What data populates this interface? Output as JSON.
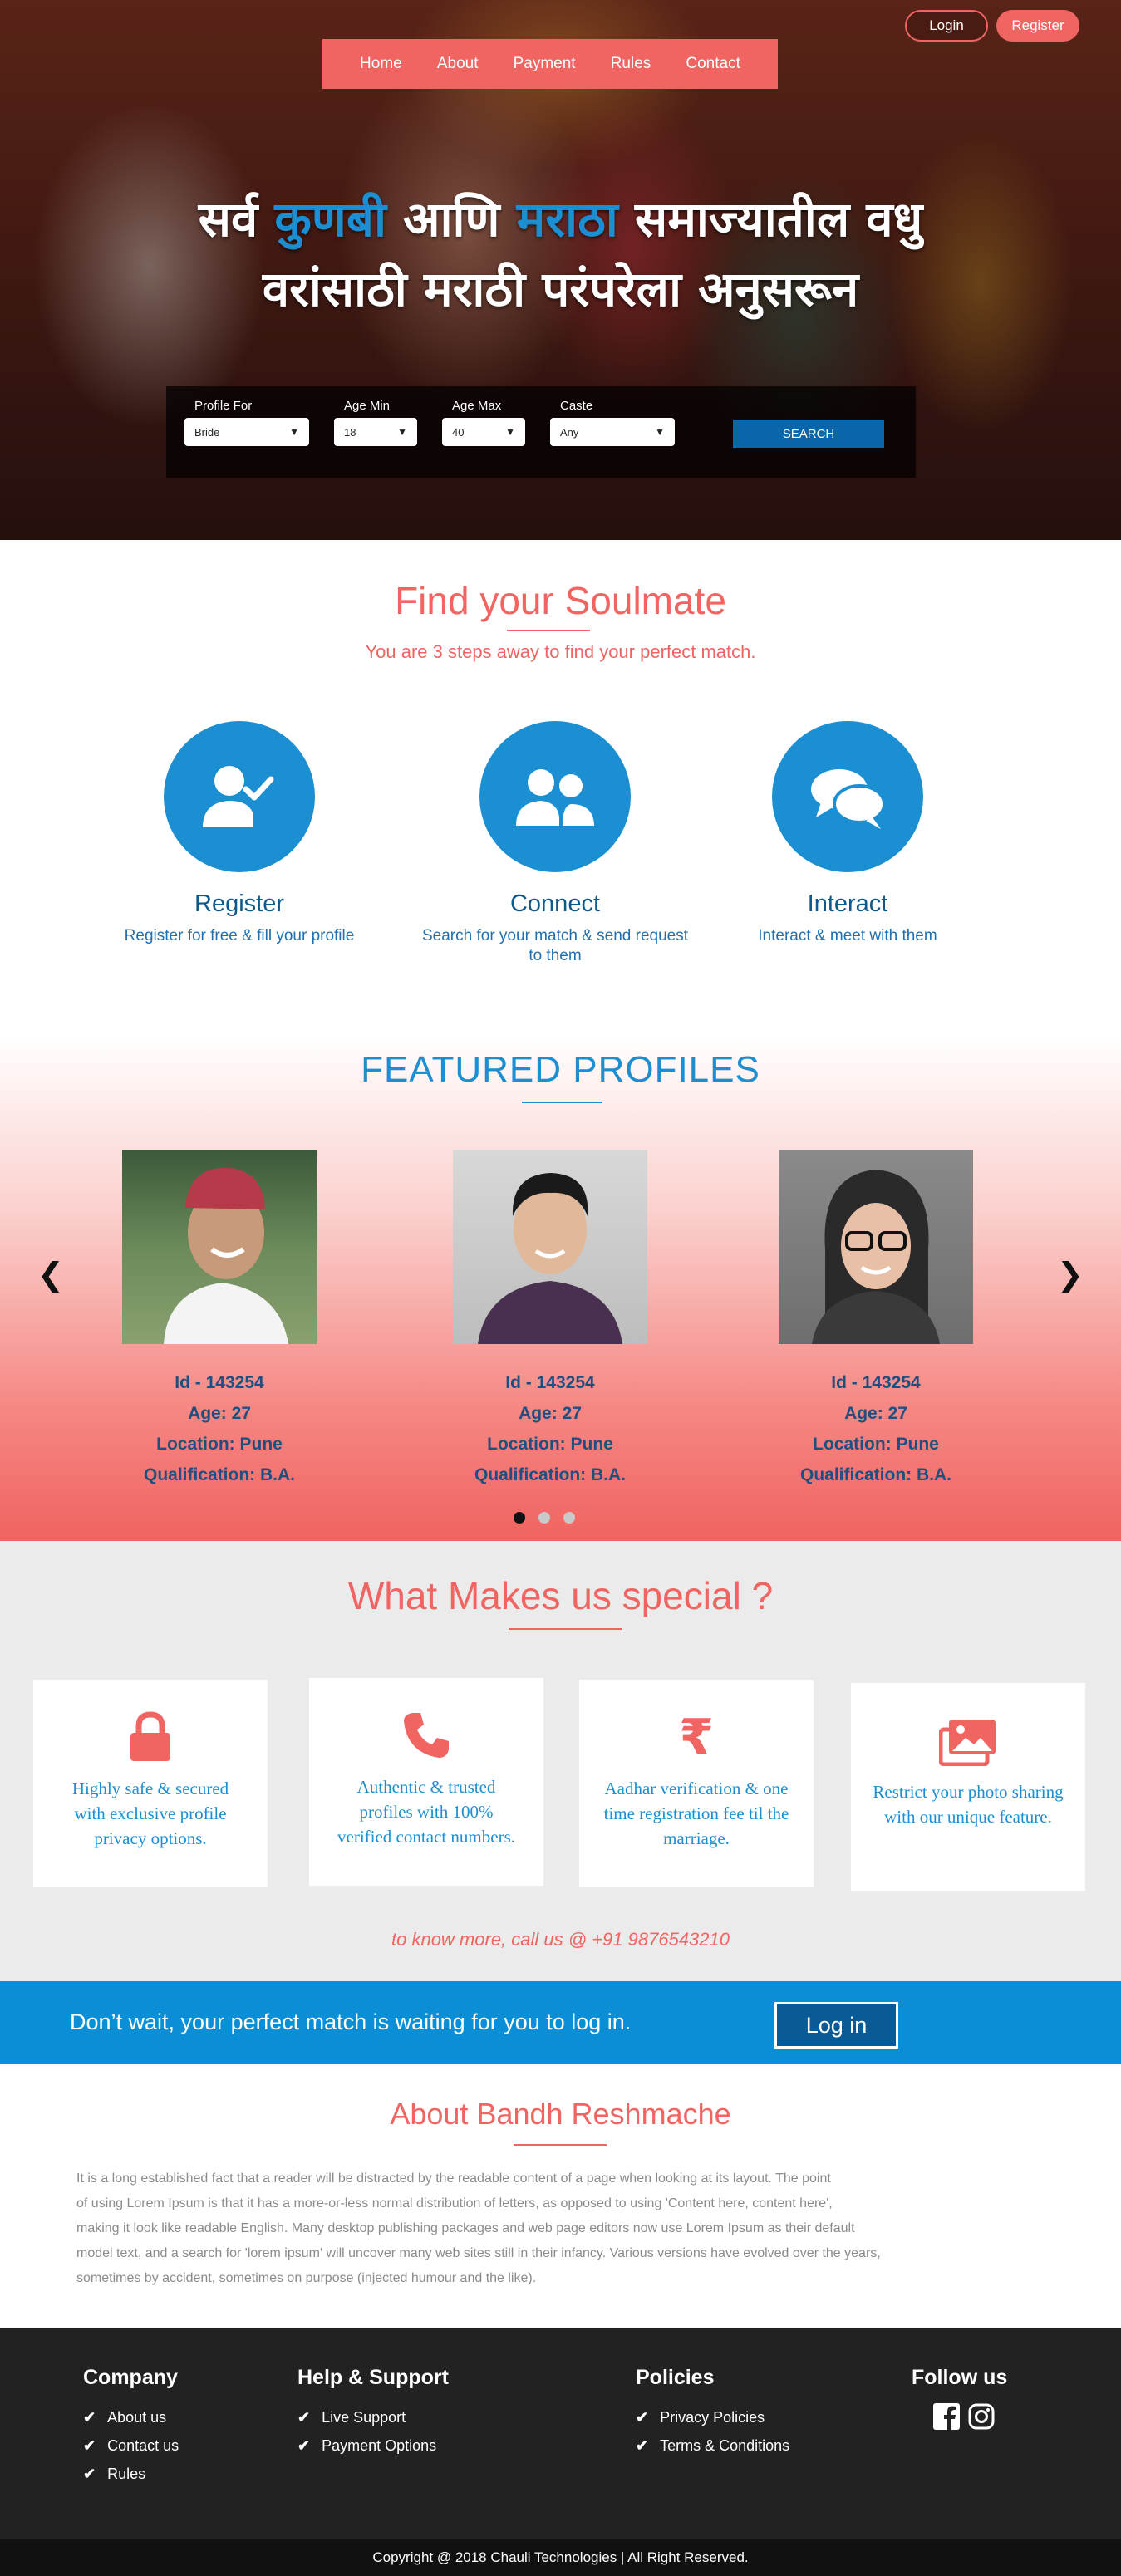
{
  "nav": {
    "items": [
      "Home",
      "About",
      "Payment",
      "Rules",
      "Contact"
    ],
    "login": "Login",
    "register": "Register"
  },
  "hero": {
    "line1_a": "सर्व ",
    "line1_b": "कुणबी",
    "line1_c": " आणि ",
    "line1_d": "मराठा",
    "line1_e": " समाज्यातील वधु",
    "line2": "वरांसाठी मराठी परंपरेला अनुसरून"
  },
  "search": {
    "profile_for_label": "Profile  For",
    "profile_for_value": "Bride",
    "age_min_label": "Age  Min",
    "age_min_value": "18",
    "age_max_label": "Age  Max",
    "age_max_value": "40",
    "caste_label": "Caste",
    "caste_value": "Any",
    "button": "SEARCH"
  },
  "soulmate": {
    "title": "Find your Soulmate",
    "subtitle": "You  are 3 steps away to find your perfect match.",
    "steps": [
      {
        "name": "Register",
        "desc": "Register for free & fill your profile",
        "icon": "user-check-icon"
      },
      {
        "name": "Connect",
        "desc": "Search for your match & send request to them",
        "icon": "users-icon"
      },
      {
        "name": "Interact",
        "desc": "Interact & meet with them",
        "icon": "chat-bubbles-icon"
      }
    ]
  },
  "featured": {
    "title": "FEATURED PROFILES",
    "profiles": [
      {
        "id": "Id - 143254",
        "age": "Age: 27",
        "location": "Location: Pune",
        "qualification": "Qualification: B.A."
      },
      {
        "id": "Id - 143254",
        "age": "Age: 27",
        "location": "Location: Pune",
        "qualification": "Qualification: B.A."
      },
      {
        "id": "Id - 143254",
        "age": "Age: 27",
        "location": "Location: Pune",
        "qualification": "Qualification: B.A."
      }
    ],
    "prev": "‹",
    "next": "›"
  },
  "special": {
    "title": "What  Makes us special ?",
    "cards": [
      {
        "icon": "lock-icon",
        "text": "Highly safe & secured with exclusive profile privacy options."
      },
      {
        "icon": "phone-icon",
        "text": "Authentic & trusted profiles with 100% verified contact numbers."
      },
      {
        "icon": "rupee-icon",
        "text": "Aadhar verification & one time registration fee til the marriage."
      },
      {
        "icon": "photos-icon",
        "text": "Restrict your photo sharing with our unique feature."
      }
    ],
    "call": "to know more, call us @ +91 9876543210"
  },
  "cta": {
    "text": "Don’t wait, your perfect match is waiting for you to log in.",
    "button": "Log in"
  },
  "about": {
    "title": "About Bandh Reshmache",
    "lines": [
      "It is a long established fact that a reader will be distracted by the readable content of a page when looking at its layout. The point",
      "of using Lorem Ipsum is that it has a more-or-less normal distribution of letters, as opposed to using 'Content here, content here',",
      "making it look like readable English. Many desktop publishing packages and web page editors now use Lorem Ipsum as their default",
      "model text, and a search for 'lorem ipsum' will uncover many web sites still in their infancy. Various versions have evolved over the years,",
      " sometimes by accident, sometimes on purpose (injected humour and the like)."
    ]
  },
  "footer": {
    "company": {
      "title": "Company",
      "items": [
        "About us",
        "Contact us",
        "Rules"
      ]
    },
    "help": {
      "title": "Help & Support",
      "items": [
        "Live Support",
        "Payment Options"
      ]
    },
    "policies": {
      "title": "Policies",
      "items": [
        "Privacy Policies",
        "Terms & Conditions"
      ]
    },
    "follow": {
      "title": "Follow us",
      "icons": [
        "facebook-icon",
        "instagram-icon"
      ]
    },
    "copyright": "Copyright @ 2018 Chauli Technologies | All Right Reserved."
  },
  "colors": {
    "accent": "#f06461",
    "blue": "#1b8fd2",
    "footer": "#222222"
  }
}
